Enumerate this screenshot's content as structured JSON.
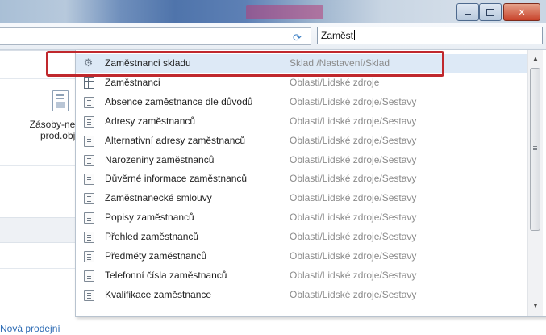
{
  "window": {
    "controls": {
      "minimize": "minimize",
      "maximize": "maximize",
      "close": "close"
    }
  },
  "search": {
    "value": "Zaměst",
    "refresh_icon": "refresh-icon"
  },
  "background": {
    "tile_label_line1": "Zásoby-ned",
    "tile_label_line2": "prod.obje",
    "link_text": "Nová prodejní"
  },
  "dropdown": {
    "highlighted_index": 0,
    "items": [
      {
        "name": "Zaměstnanci skladu",
        "path": "Sklad /Nastavení/Sklad",
        "icon": "gears-icon"
      },
      {
        "name": "Zaměstnanci",
        "path": "Oblasti/Lidské zdroje",
        "icon": "table-icon"
      },
      {
        "name": "Absence zaměstnance dle důvodů",
        "path": "Oblasti/Lidské zdroje/Sestavy",
        "icon": "report-icon"
      },
      {
        "name": "Adresy zaměstnanců",
        "path": "Oblasti/Lidské zdroje/Sestavy",
        "icon": "report-icon"
      },
      {
        "name": "Alternativní adresy zaměstnanců",
        "path": "Oblasti/Lidské zdroje/Sestavy",
        "icon": "report-icon"
      },
      {
        "name": "Narozeniny zaměstnanců",
        "path": "Oblasti/Lidské zdroje/Sestavy",
        "icon": "report-icon"
      },
      {
        "name": "Důvěrné informace zaměstnanců",
        "path": "Oblasti/Lidské zdroje/Sestavy",
        "icon": "report-icon"
      },
      {
        "name": "Zaměstnanecké smlouvy",
        "path": "Oblasti/Lidské zdroje/Sestavy",
        "icon": "report-icon"
      },
      {
        "name": "Popisy zaměstnanců",
        "path": "Oblasti/Lidské zdroje/Sestavy",
        "icon": "report-icon"
      },
      {
        "name": "Přehled zaměstnanců",
        "path": "Oblasti/Lidské zdroje/Sestavy",
        "icon": "report-icon"
      },
      {
        "name": "Předměty zaměstnanců",
        "path": "Oblasti/Lidské zdroje/Sestavy",
        "icon": "report-icon"
      },
      {
        "name": "Telefonní čísla zaměstnanců",
        "path": "Oblasti/Lidské zdroje/Sestavy",
        "icon": "report-icon"
      },
      {
        "name": "Kvalifikace zaměstnance",
        "path": "Oblasti/Lidské zdroje/Sestavy",
        "icon": "report-icon"
      }
    ]
  },
  "colors": {
    "highlight_border": "#c0282d",
    "selected_row": "#dde9f6",
    "path_text": "#8b8b8b",
    "link": "#2f6db5"
  }
}
